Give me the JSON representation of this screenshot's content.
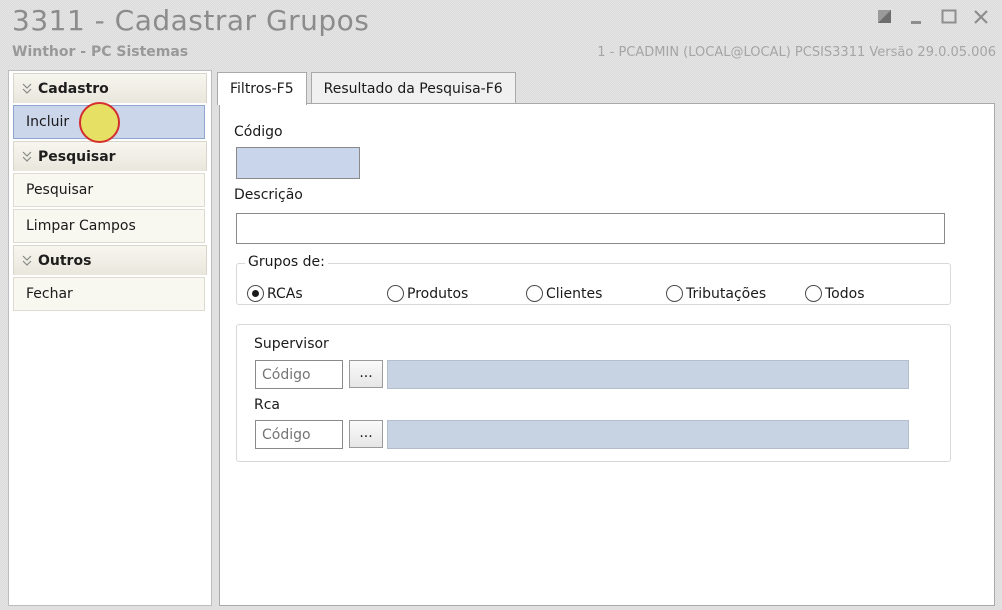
{
  "window": {
    "title": "3311 - Cadastrar Grupos",
    "subtitle": "Winthor - PC Sistemas",
    "status": "1 - PCADMIN (LOCAL@LOCAL)   PCSIS3311  Versão  29.0.05.006",
    "controls": [
      "restore-icon",
      "minimize-icon",
      "maximize-icon",
      "close-icon"
    ]
  },
  "sidebar": {
    "groups": [
      {
        "title": "Cadastro",
        "items": [
          {
            "label": "Incluir",
            "selected": true
          }
        ]
      },
      {
        "title": "Pesquisar",
        "items": [
          {
            "label": "Pesquisar"
          },
          {
            "label": "Limpar Campos"
          }
        ]
      },
      {
        "title": "Outros",
        "items": [
          {
            "label": "Fechar"
          }
        ]
      }
    ]
  },
  "tabs": [
    {
      "label": "Filtros-F5",
      "active": true
    },
    {
      "label": "Resultado da Pesquisa-F6",
      "active": false
    }
  ],
  "filters": {
    "codigo_label": "Código",
    "codigo_value": "",
    "descricao_label": "Descrição",
    "descricao_value": "",
    "grupos_legend": "Grupos de:",
    "grupos_options": [
      "RCAs",
      "Produtos",
      "Clientes",
      "Tributações",
      "Todos"
    ],
    "grupos_selected": "RCAs",
    "supervisor_label": "Supervisor",
    "supervisor_placeholder": "Código",
    "supervisor_button": "...",
    "rca_label": "Rca",
    "rca_placeholder": "Código",
    "rca_button": "..."
  },
  "colors": {
    "selected_item": "#ccd6ea",
    "input_highlight": "#c9d5ea",
    "cursor_marker_fill": "#e9e35a",
    "cursor_marker_ring": "#d42020"
  }
}
